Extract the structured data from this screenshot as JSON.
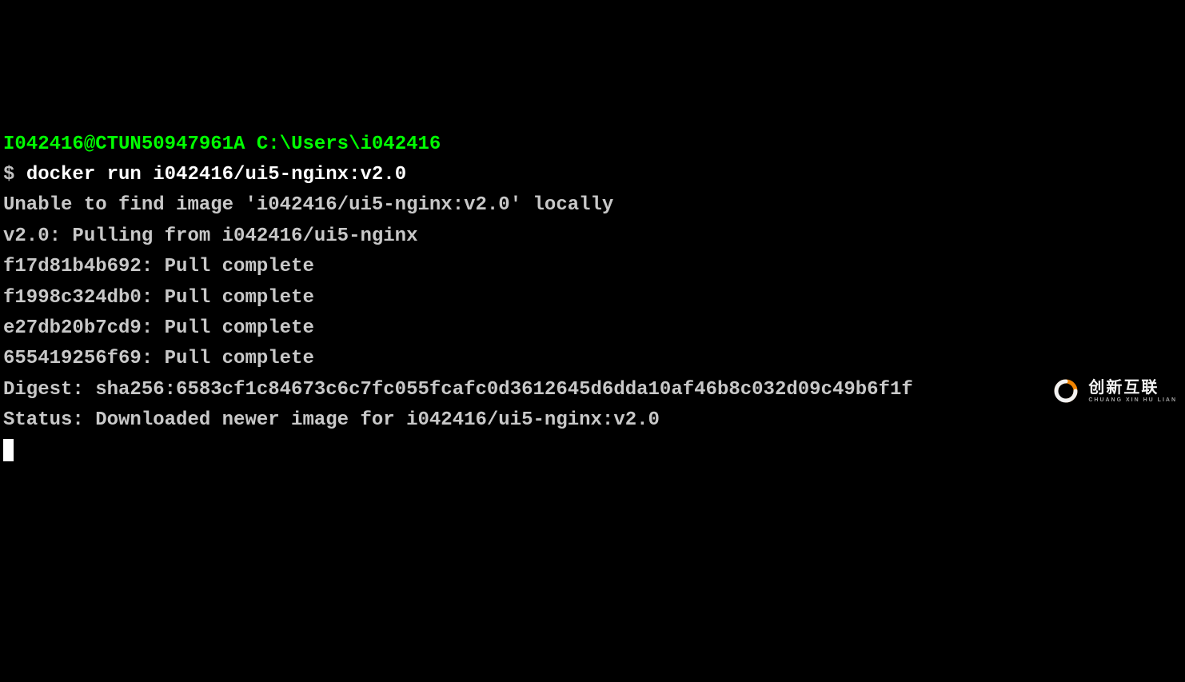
{
  "prompt": {
    "user_host": "I042416@CTUN50947961A",
    "path": "C:\\Users\\i042416",
    "symbol": "$",
    "command": "docker run i042416/ui5-nginx:v2.0"
  },
  "output_lines": [
    "Unable to find image 'i042416/ui5-nginx:v2.0' locally",
    "v2.0: Pulling from i042416/ui5-nginx",
    "f17d81b4b692: Pull complete",
    "f1998c324db0: Pull complete",
    "e27db20b7cd9: Pull complete",
    "655419256f69: Pull complete",
    "Digest: sha256:6583cf1c84673c6c7fc055fcafc0d3612645d6dda10af46b8c032d09c49b6f1f",
    "Status: Downloaded newer image for i042416/ui5-nginx:v2.0"
  ],
  "watermark": {
    "main": "创新互联",
    "sub": "CHUANG XIN HU LIAN"
  }
}
